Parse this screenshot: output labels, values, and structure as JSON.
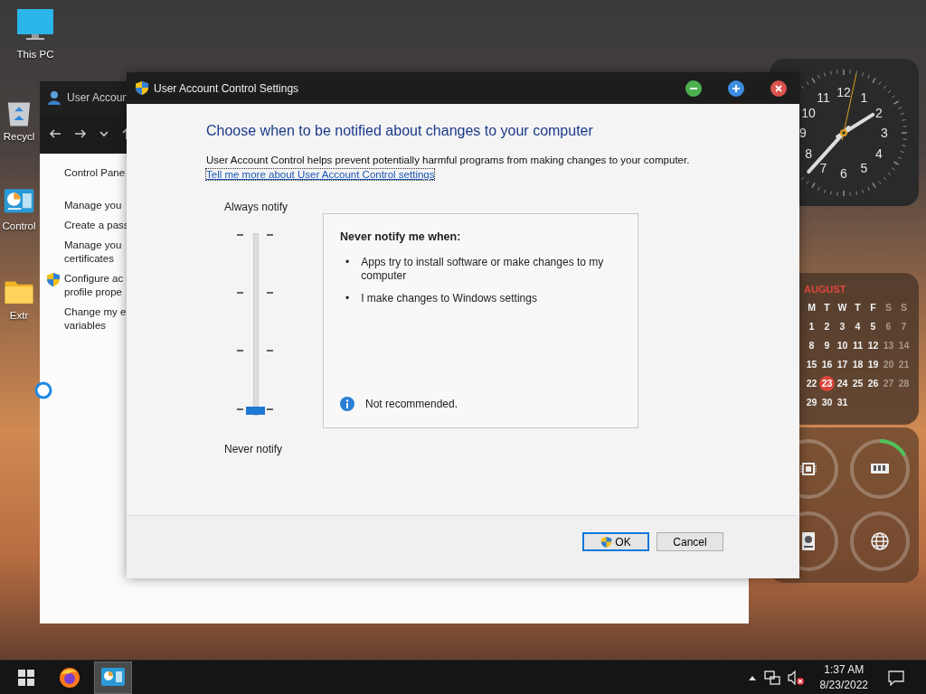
{
  "desktop_icons": [
    {
      "label": "This PC",
      "kind": "pc"
    },
    {
      "label": "Recycl",
      "kind": "recycle"
    },
    {
      "label": "Control",
      "kind": "control"
    },
    {
      "label": "Extr",
      "kind": "folder"
    }
  ],
  "background_window": {
    "title": "User Accoun",
    "sidebar": [
      {
        "lines": [
          "Control Pane"
        ],
        "kind": "plain"
      },
      {
        "lines": [
          "Manage you"
        ],
        "kind": "plain"
      },
      {
        "lines": [
          "Create a pass"
        ],
        "kind": "plain"
      },
      {
        "lines": [
          "Manage you",
          "certificates"
        ],
        "kind": "plain"
      },
      {
        "lines": [
          "Configure ac",
          "profile prope"
        ],
        "kind": "shield"
      },
      {
        "lines": [
          "Change my e",
          "variables"
        ],
        "kind": "plain"
      }
    ]
  },
  "dialog": {
    "title": "User Account Control Settings",
    "heading": "Choose when to be notified about changes to your computer",
    "description": "User Account Control helps prevent potentially harmful programs from making changes to your computer.",
    "link": "Tell me more about User Account Control settings",
    "slider": {
      "top_label": "Always notify",
      "bottom_label": "Never notify",
      "level": 0
    },
    "info_box": {
      "heading": "Never notify me when:",
      "bullets": [
        {
          "marker": "•",
          "text": "Apps try to install software or make changes to my computer"
        },
        {
          "marker": "•",
          "text": "I make changes to Windows settings"
        }
      ],
      "note": "Not recommended."
    },
    "buttons": [
      {
        "label": "OK",
        "kind": "shield",
        "default": true
      },
      {
        "label": "Cancel",
        "kind": "plain",
        "default": false
      }
    ]
  },
  "clock_widget": {
    "numbers": [
      "12",
      "1",
      "2",
      "3",
      "4",
      "5",
      "6",
      "7",
      "8",
      "9",
      "10",
      "11"
    ]
  },
  "calendar_widget": {
    "month": "AUGUST",
    "weekdays": [
      "M",
      "T",
      "W",
      "T",
      "F",
      "S",
      "S"
    ],
    "weeks": [
      [
        {
          "day": "1",
          "selected": false
        },
        {
          "day": "2",
          "selected": false
        },
        {
          "day": "3",
          "selected": false
        },
        {
          "day": "4",
          "selected": false
        },
        {
          "day": "5",
          "selected": false
        },
        {
          "day": "6",
          "selected": false
        },
        {
          "day": "7",
          "selected": false
        }
      ],
      [
        {
          "day": "8",
          "selected": false
        },
        {
          "day": "9",
          "selected": false
        },
        {
          "day": "10",
          "selected": false
        },
        {
          "day": "11",
          "selected": false
        },
        {
          "day": "12",
          "selected": false
        },
        {
          "day": "13",
          "selected": false
        },
        {
          "day": "14",
          "selected": false
        }
      ],
      [
        {
          "day": "15",
          "selected": false
        },
        {
          "day": "16",
          "selected": false
        },
        {
          "day": "17",
          "selected": false
        },
        {
          "day": "18",
          "selected": false
        },
        {
          "day": "19",
          "selected": false
        },
        {
          "day": "20",
          "selected": false
        },
        {
          "day": "21",
          "selected": false
        }
      ],
      [
        {
          "day": "22",
          "selected": false
        },
        {
          "day": "23",
          "selected": true
        },
        {
          "day": "24",
          "selected": false
        },
        {
          "day": "25",
          "selected": false
        },
        {
          "day": "26",
          "selected": false
        },
        {
          "day": "27",
          "selected": false
        },
        {
          "day": "28",
          "selected": false
        }
      ],
      [
        {
          "day": "29",
          "selected": false
        },
        {
          "day": "30",
          "selected": false
        },
        {
          "day": "31",
          "selected": false
        }
      ]
    ]
  },
  "monitor_widget": {
    "gauges": [
      {
        "kind": "cpu"
      },
      {
        "kind": "memory"
      },
      {
        "kind": "disk"
      },
      {
        "kind": "network"
      }
    ]
  },
  "taskbar": {
    "apps": [
      {
        "kind": "start",
        "selected": false
      },
      {
        "kind": "firefox",
        "selected": false
      },
      {
        "kind": "control",
        "selected": true
      }
    ],
    "time": "1:37 AM",
    "date": "8/23/2022"
  }
}
